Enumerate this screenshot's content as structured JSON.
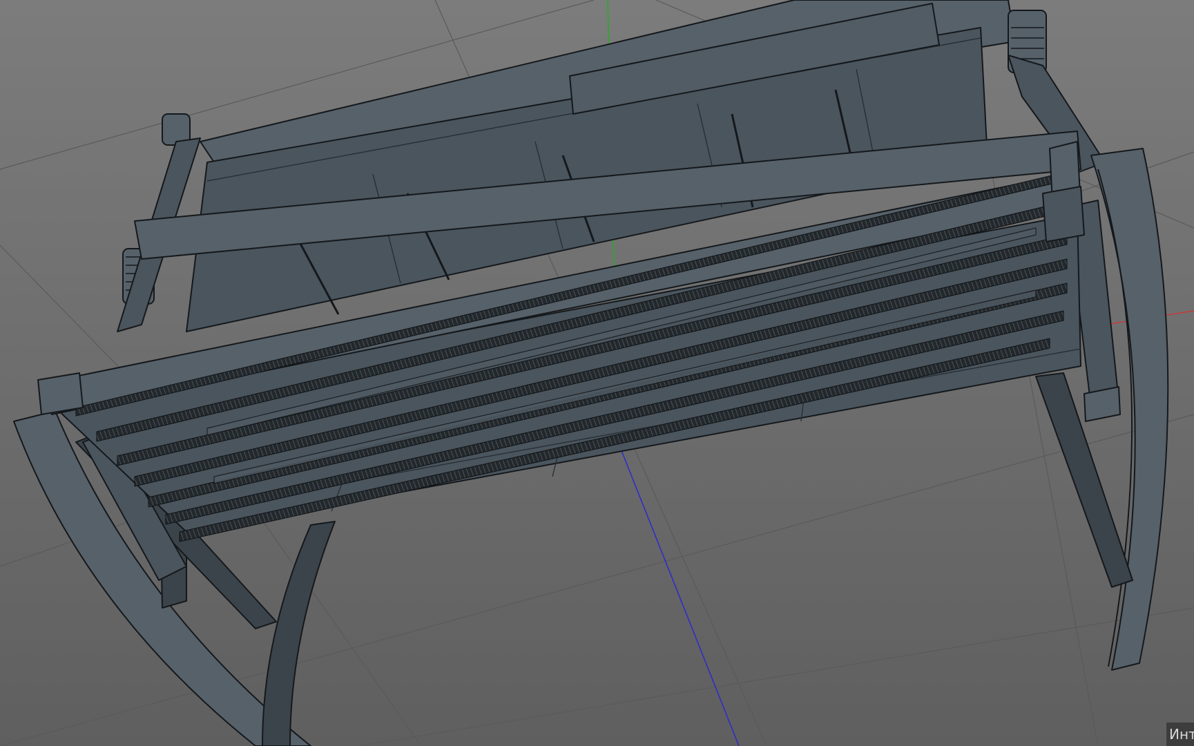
{
  "viewport": {
    "name": "3d-viewport",
    "object": "rocking-bench",
    "display_mode": "shaded-with-lines",
    "axes": {
      "x_color": "#d83030",
      "y_color": "#20b020",
      "z_color": "#2a2ad0"
    },
    "colors": {
      "background_top": "#7c7c7c",
      "background_bottom": "#5f5f5f",
      "grid": "#585858",
      "surface": "#4a555e",
      "surface_light": "#56616a",
      "surface_dark": "#3b444b",
      "edge": "#15181b",
      "dowel": "#1f2326"
    },
    "corner_label": "Инте"
  }
}
